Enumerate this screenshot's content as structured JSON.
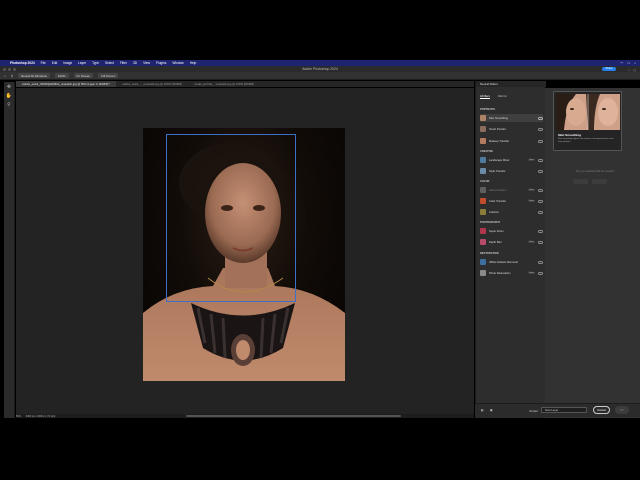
{
  "menubar": {
    "app": "Photoshop 2024",
    "items": [
      "File",
      "Edit",
      "Image",
      "Layer",
      "Type",
      "Select",
      "Filter",
      "3D",
      "View",
      "Plugins",
      "Window",
      "Help"
    ]
  },
  "window": {
    "title": "Adobe Photoshop 2024",
    "share_label": "Share"
  },
  "options": {
    "buttons": [
      "Neural All Windows",
      "100%",
      "Fit Screen",
      "Fill Screen"
    ]
  },
  "tabs": [
    {
      "label": "Adobe_stock_n8zfRQEHMNA_unsplash.jpg @ 50% (Layer 0, RGB/8) *",
      "active": true
    },
    {
      "label": "adobe_stock_..._unsplash.jpg @ 100% (RGB/8)",
      "active": false
    },
    {
      "label": "model_portrait_...unsplash.jpg @ 100% (RGB/8)",
      "active": false
    }
  ],
  "status": {
    "zoom": "50%",
    "doc": "3000 px x 3000 px (72 ppi)"
  },
  "neural": {
    "panel_title": "Neural Filters",
    "tabs": [
      "All filters",
      "Wait list"
    ],
    "groups": [
      {
        "label": "PORTRAITS",
        "filters": [
          {
            "name": "Skin Smoothing",
            "tag": "",
            "active": true,
            "color": "#b08266"
          },
          {
            "name": "Smart Portrait",
            "tag": "",
            "active": false,
            "color": "#8a6d5c"
          },
          {
            "name": "Makeup Transfer",
            "tag": "",
            "active": false,
            "color": "#b27a5f"
          }
        ]
      },
      {
        "label": "CREATIVE",
        "filters": [
          {
            "name": "Landscape Mixer",
            "tag": "Beta",
            "active": false,
            "color": "#4f7a9b"
          },
          {
            "name": "Style Transfer",
            "tag": "",
            "active": false,
            "color": "#6b8aa8"
          }
        ]
      },
      {
        "label": "COLOR",
        "filters": [
          {
            "name": "Harmonization",
            "tag": "Beta",
            "active": false,
            "color": "#5f5f5f"
          },
          {
            "name": "Color Transfer",
            "tag": "Beta",
            "active": false,
            "color": "#c24d2c"
          },
          {
            "name": "Colorize",
            "tag": "",
            "active": false,
            "color": "#8d7d3b"
          }
        ]
      },
      {
        "label": "PHOTOGRAPHY",
        "filters": [
          {
            "name": "Super Zoom",
            "tag": "",
            "active": false,
            "color": "#b1374f"
          },
          {
            "name": "Depth Blur",
            "tag": "Beta",
            "active": false,
            "color": "#b84a6a"
          }
        ]
      },
      {
        "label": "RESTORATION",
        "filters": [
          {
            "name": "JPEG Artifacts Removal",
            "tag": "",
            "active": false,
            "color": "#3d6fa0"
          },
          {
            "name": "Photo Restoration",
            "tag": "Beta",
            "active": false,
            "color": "#8a8a8a"
          }
        ]
      }
    ],
    "preview": {
      "title": "Skin Smoothing",
      "description": "Skin smoothing adjusts skin textures and imperfections and ... from portraits."
    },
    "detail_info": "Are you satisfied with the results?",
    "output_label": "Output",
    "output_value": "New Layer",
    "cancel_label": "Cancel",
    "ok_label": "OK"
  }
}
